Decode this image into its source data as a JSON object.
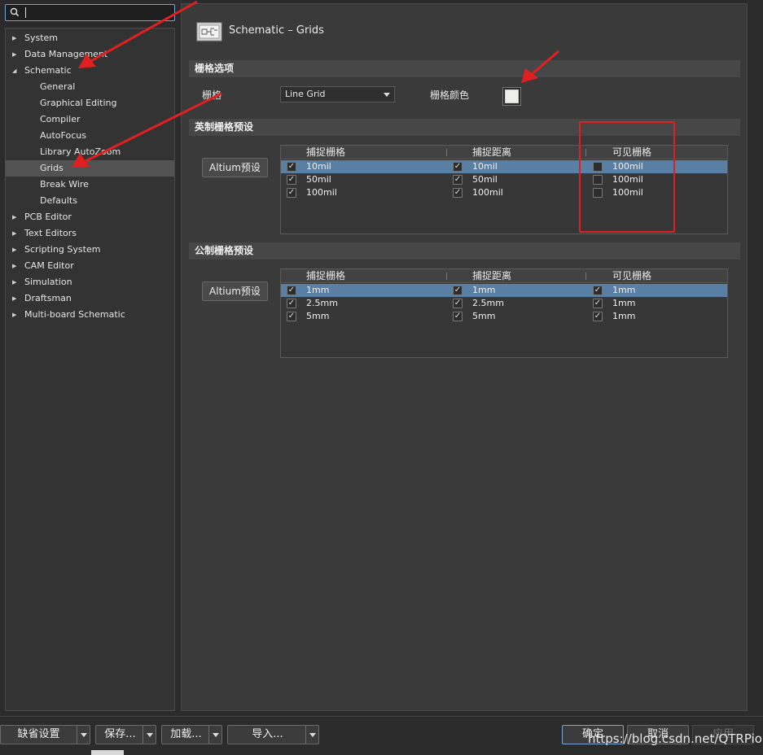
{
  "search": {
    "value": ""
  },
  "tree": [
    {
      "label": "System",
      "expanded": false,
      "level": 0,
      "selected": false
    },
    {
      "label": "Data Management",
      "expanded": false,
      "level": 0,
      "selected": false
    },
    {
      "label": "Schematic",
      "expanded": true,
      "level": 0,
      "selected": false
    },
    {
      "label": "General",
      "level": 1,
      "selected": false
    },
    {
      "label": "Graphical Editing",
      "level": 1,
      "selected": false
    },
    {
      "label": "Compiler",
      "level": 1,
      "selected": false
    },
    {
      "label": "AutoFocus",
      "level": 1,
      "selected": false
    },
    {
      "label": "Library AutoZoom",
      "level": 1,
      "selected": false
    },
    {
      "label": "Grids",
      "level": 1,
      "selected": true
    },
    {
      "label": "Break Wire",
      "level": 1,
      "selected": false
    },
    {
      "label": "Defaults",
      "level": 1,
      "selected": false
    },
    {
      "label": "PCB Editor",
      "expanded": false,
      "level": 0,
      "selected": false
    },
    {
      "label": "Text Editors",
      "expanded": false,
      "level": 0,
      "selected": false
    },
    {
      "label": "Scripting System",
      "expanded": false,
      "level": 0,
      "selected": false
    },
    {
      "label": "CAM Editor",
      "expanded": false,
      "level": 0,
      "selected": false
    },
    {
      "label": "Simulation",
      "expanded": false,
      "level": 0,
      "selected": false
    },
    {
      "label": "Draftsman",
      "expanded": false,
      "level": 0,
      "selected": false
    },
    {
      "label": "Multi-board Schematic",
      "expanded": false,
      "level": 0,
      "selected": false
    }
  ],
  "page": {
    "title": "Schematic – Grids"
  },
  "grid_options": {
    "section_title": "栅格选项",
    "grid_label": "栅格",
    "grid_value": "Line Grid",
    "color_label": "栅格颜色",
    "color": "#eeeeea"
  },
  "imperial": {
    "section_title": "英制栅格预设",
    "preset_button": "Altium预设",
    "headers": [
      "捕捉栅格",
      "捕捉距离",
      "可见栅格"
    ],
    "rows": [
      {
        "snap": "10mil",
        "snap_checked": true,
        "distance": "10mil",
        "distance_checked": true,
        "visible": "100mil",
        "visible_checked": false,
        "selected": true
      },
      {
        "snap": "50mil",
        "snap_checked": true,
        "distance": "50mil",
        "distance_checked": true,
        "visible": "100mil",
        "visible_checked": false,
        "selected": false
      },
      {
        "snap": "100mil",
        "snap_checked": true,
        "distance": "100mil",
        "distance_checked": true,
        "visible": "100mil",
        "visible_checked": false,
        "selected": false
      }
    ]
  },
  "metric": {
    "section_title": "公制栅格预设",
    "preset_button": "Altium预设",
    "headers": [
      "捕捉栅格",
      "捕捉距离",
      "可见栅格"
    ],
    "rows": [
      {
        "snap": "1mm",
        "snap_checked": true,
        "distance": "1mm",
        "distance_checked": true,
        "visible": "1mm",
        "visible_checked": true,
        "selected": true
      },
      {
        "snap": "2.5mm",
        "snap_checked": true,
        "distance": "2.5mm",
        "distance_checked": true,
        "visible": "1mm",
        "visible_checked": true,
        "selected": false
      },
      {
        "snap": "5mm",
        "snap_checked": true,
        "distance": "5mm",
        "distance_checked": true,
        "visible": "1mm",
        "visible_checked": true,
        "selected": false
      }
    ]
  },
  "footer": {
    "defaults": "缺省设置",
    "save": "保存...",
    "load": "加载...",
    "import": "导入...",
    "ok": "确定",
    "cancel": "取消",
    "apply": "应用"
  },
  "watermark": "https://blog.csdn.net/QTRPio",
  "colors": {
    "accent": "#7aa3d6",
    "selection": "#5a7fa5",
    "annotation": "#e02020"
  },
  "icons": [
    "search-icon",
    "expand-arrow-icon",
    "collapse-arrow-icon",
    "schematic-icon",
    "dropdown-arrow-icon",
    "checkmark-icon"
  ]
}
